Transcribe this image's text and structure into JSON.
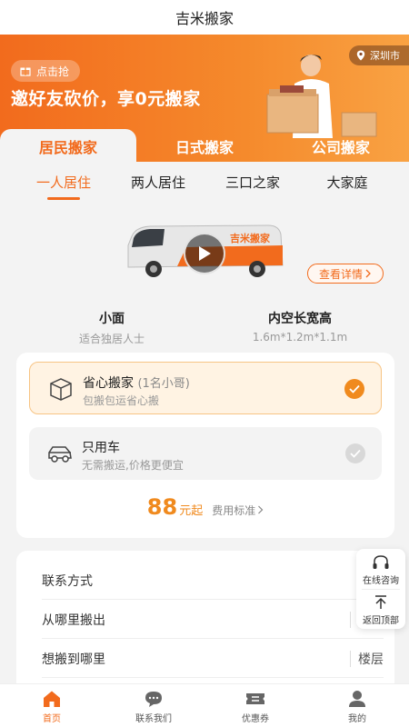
{
  "app_title": "吉米搬家",
  "banner": {
    "pill_label": "点击抢",
    "headline": "邀好友砍价，享0元搬家",
    "city": "深圳市"
  },
  "tabs": [
    {
      "label": "居民搬家",
      "active": true
    },
    {
      "label": "日式搬家",
      "active": false
    },
    {
      "label": "公司搬家",
      "active": false
    }
  ],
  "subtabs": [
    {
      "label": "一人居住",
      "active": true
    },
    {
      "label": "两人居住",
      "active": false
    },
    {
      "label": "三口之家",
      "active": false
    },
    {
      "label": "大家庭",
      "active": false
    }
  ],
  "vehicle": {
    "brand_text": "吉米搬家",
    "details_label": "查看详情"
  },
  "specs": [
    {
      "title": "小面",
      "subtitle": "适合独居人士"
    },
    {
      "title": "内空长宽高",
      "subtitle": "1.6m*1.2m*1.1m"
    }
  ],
  "options": [
    {
      "name": "省心搬家",
      "hint": "(1名小哥)",
      "desc": "包搬包运省心搬",
      "selected": true,
      "icon": "box-icon"
    },
    {
      "name": "只用车",
      "hint": "",
      "desc": "无需搬运,价格更便宜",
      "selected": false,
      "icon": "car-icon"
    }
  ],
  "price": {
    "value": "88",
    "unit": "元起",
    "link": "费用标准"
  },
  "form": {
    "contact": "联系方式",
    "from": "从哪里搬出",
    "from_floor": "楼层",
    "to": "想搬到哪里",
    "to_floor": "楼层"
  },
  "float_panel": {
    "consult": "在线咨询",
    "top": "返回顶部"
  },
  "bottom_nav": [
    {
      "label": "首页",
      "icon": "home-icon",
      "active": true
    },
    {
      "label": "联系我们",
      "icon": "chat-icon",
      "active": false
    },
    {
      "label": "优惠券",
      "icon": "ticket-icon",
      "active": false
    },
    {
      "label": "我的",
      "icon": "user-icon",
      "active": false
    }
  ],
  "colors": {
    "accent": "#f26b1d",
    "accent_light": "#fff3e3",
    "price": "#f08a1e"
  }
}
